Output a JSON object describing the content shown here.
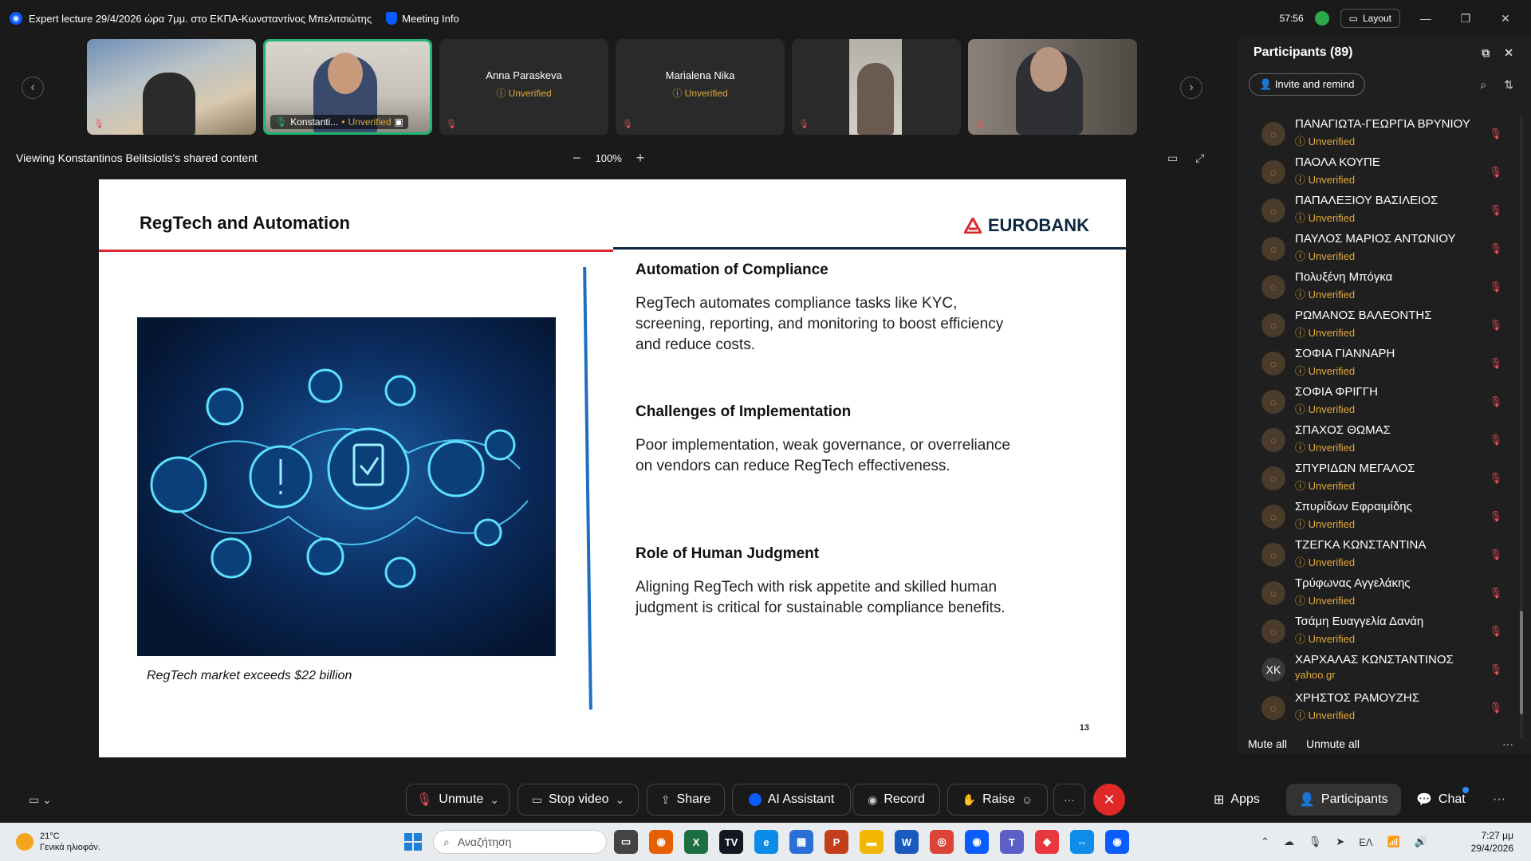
{
  "window": {
    "title": "Expert lecture 29/4/2026 ώρα 7μμ. στο ΕΚΠΑ-Κωνσταντίνος Μπελιτσιώτης",
    "meeting_info": "Meeting Info",
    "timer": "57:56",
    "layout_label": "Layout"
  },
  "video_strip": {
    "tiles": [
      {
        "name": ""
      },
      {
        "name": "Konstanti...",
        "status": "Unverified"
      },
      {
        "name": "Anna Paraskeva",
        "status": "Unverified"
      },
      {
        "name": "Marialena Nika",
        "status": "Unverified"
      },
      {
        "name": ""
      },
      {
        "name": ""
      }
    ]
  },
  "share_bar": {
    "viewing": "Viewing Konstantinos Belitsiotis's shared content",
    "zoom": "100%"
  },
  "slide": {
    "title": "RegTech and Automation",
    "brand": "EUROBANK",
    "caption": "RegTech market exceeds $22 billion",
    "sections": [
      {
        "heading": "Automation of Compliance",
        "body": "RegTech automates compliance tasks like KYC, screening, reporting, and monitoring to boost efficiency and reduce costs."
      },
      {
        "heading": "Challenges of Implementation",
        "body": "Poor implementation, weak governance, or overreliance on vendors can reduce RegTech effectiveness."
      },
      {
        "heading": "Role of Human Judgment",
        "body": "Aligning RegTech with risk appetite and skilled human judgment is critical for sustainable compliance benefits."
      }
    ],
    "page_number": "13"
  },
  "participants": {
    "header": "Participants (89)",
    "invite": "Invite and remind",
    "list": [
      {
        "name": "ΠΑΝΑΓΙΩΤΑ-ΓΕΩΡΓΙΑ ΒΡΥΝΙΟΥ",
        "status": "Unverified",
        "initials": ""
      },
      {
        "name": "ΠΑΟΛΑ ΚΟΥΠΕ",
        "status": "Unverified",
        "initials": ""
      },
      {
        "name": "ΠΑΠΑΛΕΞΙΟΥ ΒΑΣΙΛΕΙΟΣ",
        "status": "Unverified",
        "initials": ""
      },
      {
        "name": "ΠΑΥΛΟΣ ΜΑΡΙΟΣ ΑΝΤΩΝΙΟΥ",
        "status": "Unverified",
        "initials": ""
      },
      {
        "name": "Πολυξένη Μπόγκα",
        "status": "Unverified",
        "initials": ""
      },
      {
        "name": "ΡΩΜΑΝΟΣ ΒΑΛΕΟΝΤΗΣ",
        "status": "Unverified",
        "initials": ""
      },
      {
        "name": "ΣΟΦΙΑ ΓΙΑΝΝΑΡΗ",
        "status": "Unverified",
        "initials": ""
      },
      {
        "name": "ΣΟΦΙΑ ΦΡΙΓΓΗ",
        "status": "Unverified",
        "initials": ""
      },
      {
        "name": "ΣΠΑΧΟΣ ΘΩΜΑΣ",
        "status": "Unverified",
        "initials": ""
      },
      {
        "name": "ΣΠΥΡΙΔΩΝ ΜΕΓΑΛΟΣ",
        "status": "Unverified",
        "initials": ""
      },
      {
        "name": "Σπυρίδων Εφραιμίδης",
        "status": "Unverified",
        "initials": ""
      },
      {
        "name": "ΤΖΕΓΚΑ ΚΩΝΣΤΑΝΤΙΝΑ",
        "status": "Unverified",
        "initials": ""
      },
      {
        "name": "Τρύφωνας Αγγελάκης",
        "status": "Unverified",
        "initials": ""
      },
      {
        "name": "Τσάμη Ευαγγελία Δανάη",
        "status": "Unverified",
        "initials": ""
      },
      {
        "name": "ΧΑΡΧΑΛΑΣ ΚΩΝΣΤΑΝΤΙΝΟΣ",
        "status": "yahoo.gr",
        "initials": "XK"
      },
      {
        "name": "ΧΡΗΣΤΟΣ ΡΑΜΟΥΖΗΣ",
        "status": "Unverified",
        "initials": ""
      }
    ],
    "mute_all": "Mute all",
    "unmute_all": "Unmute all"
  },
  "toolbar": {
    "unmute": "Unmute",
    "stop_video": "Stop video",
    "share": "Share",
    "ai_assistant": "AI Assistant",
    "record": "Record",
    "raise": "Raise",
    "apps": "Apps",
    "participants": "Participants",
    "chat": "Chat"
  },
  "taskbar": {
    "temperature": "21°C",
    "weather": "Γενικά ηλιοφάν.",
    "search_placeholder": "Αναζήτηση",
    "language": "ΕΛ",
    "time": "7:27 μμ",
    "date": "29/4/2026"
  },
  "colors": {
    "accent": "#0b5cff",
    "unverified": "#e0a93b",
    "mute_red": "#e8505b",
    "end_red": "#e02828",
    "eurobank_red": "#d9272e",
    "eurobank_navy": "#0e2841"
  }
}
